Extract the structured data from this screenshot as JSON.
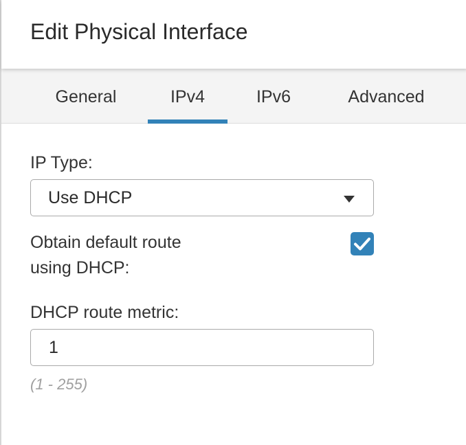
{
  "dialog": {
    "title": "Edit Physical Interface"
  },
  "tabs": [
    {
      "label": "General",
      "active": false
    },
    {
      "label": "IPv4",
      "active": true
    },
    {
      "label": "IPv6",
      "active": false
    },
    {
      "label": "Advanced",
      "active": false
    }
  ],
  "form": {
    "ip_type": {
      "label": "IP Type:",
      "value": "Use DHCP",
      "icon": "chevron-down-icon"
    },
    "default_route": {
      "label_line1": "Obtain default route",
      "label_line2": "using DHCP:",
      "checked": true,
      "icon": "checkmark-icon"
    },
    "route_metric": {
      "label": "DHCP route metric:",
      "value": "1",
      "hint": "(1 - 255)"
    }
  },
  "colors": {
    "accent": "#3282b8",
    "tabbar_bg": "#f4f4f4",
    "hint_text": "#a0a0a0"
  }
}
